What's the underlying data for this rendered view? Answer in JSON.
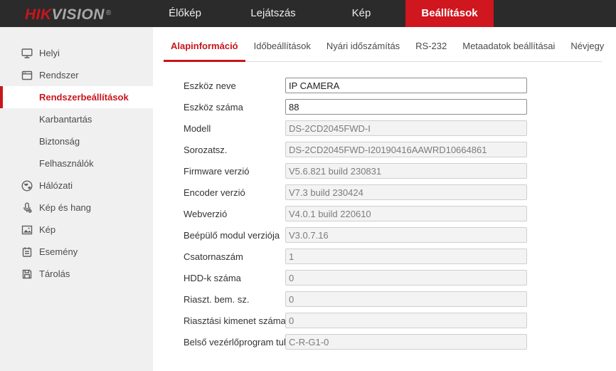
{
  "colors": {
    "accent_red": "#c9161c",
    "nav_active_red": "#d0161e",
    "topbar_bg": "#2b2b2b",
    "sidebar_bg": "#f0f0f0"
  },
  "topbar": {
    "logo": {
      "hik": "HIK",
      "vision": "VISION",
      "reg": "®"
    },
    "tabs": [
      {
        "label": "Élőkép",
        "active": false
      },
      {
        "label": "Lejátszás",
        "active": false
      },
      {
        "label": "Kép",
        "active": false
      },
      {
        "label": "Beállítások",
        "active": true
      }
    ]
  },
  "sidebar": {
    "items": [
      {
        "label": "Helyi",
        "icon": "monitor-icon"
      },
      {
        "label": "Rendszer",
        "icon": "window-icon"
      },
      {
        "label": "Rendszerbeállítások",
        "icon": null,
        "selected": true
      },
      {
        "label": "Karbantartás",
        "icon": null
      },
      {
        "label": "Biztonság",
        "icon": null
      },
      {
        "label": "Felhasználók",
        "icon": null
      },
      {
        "label": "Hálózati",
        "icon": "globe-icon"
      },
      {
        "label": "Kép és hang",
        "icon": "microphone-icon"
      },
      {
        "label": "Kép",
        "icon": "image-icon"
      },
      {
        "label": "Esemény",
        "icon": "notepad-icon"
      },
      {
        "label": "Tárolás",
        "icon": "floppy-icon"
      }
    ]
  },
  "main": {
    "tabs": [
      {
        "label": "Alapinformáció",
        "active": true
      },
      {
        "label": "Időbeállítások",
        "active": false
      },
      {
        "label": "Nyári időszámítás",
        "active": false
      },
      {
        "label": "RS-232",
        "active": false
      },
      {
        "label": "Metaadatok beállításai",
        "active": false
      },
      {
        "label": "Névjegy",
        "active": false
      }
    ],
    "form": {
      "rows": [
        {
          "label": "Eszköz neve",
          "value": "IP CAMERA",
          "editable": true
        },
        {
          "label": "Eszköz száma",
          "value": "88",
          "editable": true
        },
        {
          "label": "Modell",
          "value": "DS-2CD2045FWD-I",
          "editable": false
        },
        {
          "label": "Sorozatsz.",
          "value": "DS-2CD2045FWD-I20190416AAWRD10664861",
          "editable": false
        },
        {
          "label": "Firmware verzió",
          "value": "V5.6.821 build 230831",
          "editable": false
        },
        {
          "label": "Encoder verzió",
          "value": "V7.3 build 230424",
          "editable": false
        },
        {
          "label": "Webverzió",
          "value": "V4.0.1 build 220610",
          "editable": false
        },
        {
          "label": "Beépülő modul verziója",
          "value": "V3.0.7.16",
          "editable": false
        },
        {
          "label": "Csatornaszám",
          "value": "1",
          "editable": false
        },
        {
          "label": "HDD-k száma",
          "value": "0",
          "editable": false
        },
        {
          "label": "Riaszt. bem. sz.",
          "value": "0",
          "editable": false
        },
        {
          "label": "Riasztási kimenet száma",
          "value": "0",
          "editable": false
        },
        {
          "label": "Belső vezérlőprogram tul...",
          "value": "C-R-G1-0",
          "editable": false
        }
      ]
    }
  }
}
